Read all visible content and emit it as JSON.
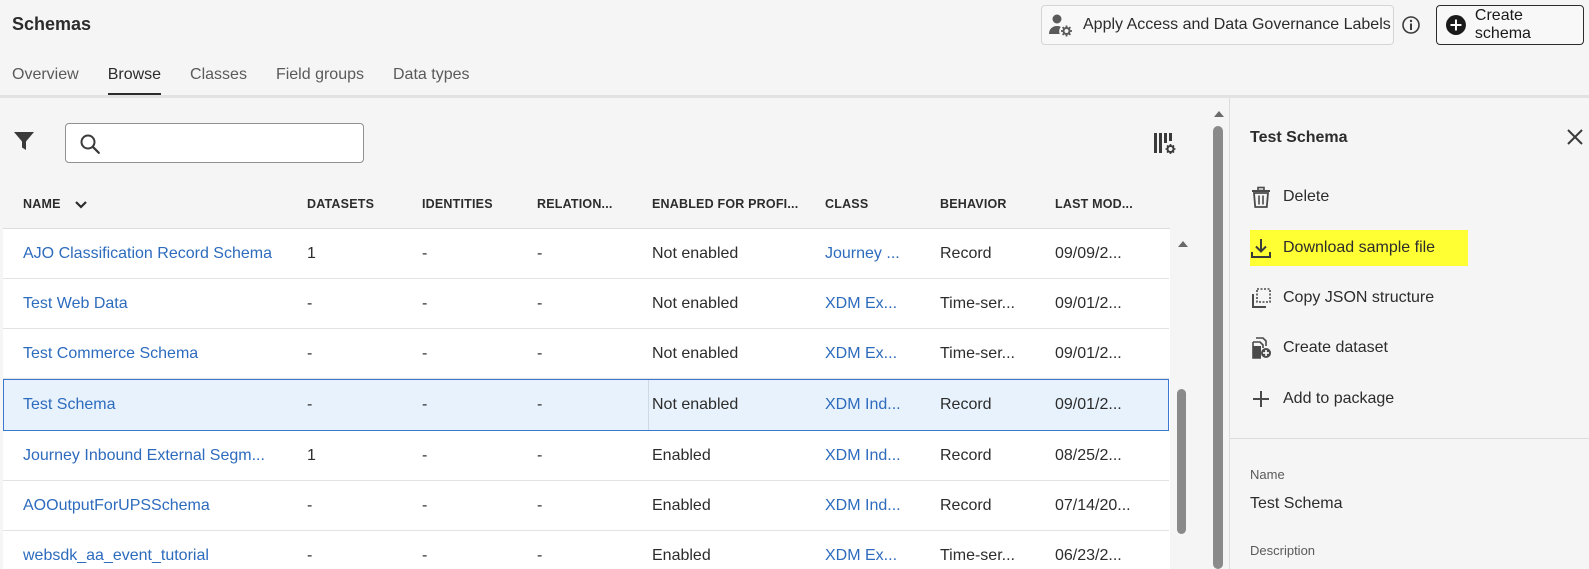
{
  "header": {
    "title": "Schemas",
    "apply_labels_button": "Apply Access and Data Governance Labels",
    "create_schema_button": "Create schema"
  },
  "tabs": [
    {
      "label": "Overview",
      "active": false
    },
    {
      "label": "Browse",
      "active": true
    },
    {
      "label": "Classes",
      "active": false
    },
    {
      "label": "Field groups",
      "active": false
    },
    {
      "label": "Data types",
      "active": false
    }
  ],
  "search": {
    "value": "",
    "placeholder": ""
  },
  "table": {
    "columns": [
      "NAME",
      "DATASETS",
      "IDENTITIES",
      "RELATION...",
      "ENABLED FOR PROFI...",
      "CLASS",
      "BEHAVIOR",
      "LAST MOD..."
    ],
    "sort_column": "NAME",
    "rows": [
      {
        "name": "AJO Classification Record Schema",
        "datasets": "1",
        "identities": "-",
        "relationships": "-",
        "profile": "Not enabled",
        "class": "Journey ...",
        "behavior": "Record",
        "last_modified": "09/09/2..."
      },
      {
        "name": "Test Web Data",
        "datasets": "-",
        "identities": "-",
        "relationships": "-",
        "profile": "Not enabled",
        "class": "XDM Ex...",
        "behavior": "Time-ser...",
        "last_modified": "09/01/2..."
      },
      {
        "name": "Test Commerce Schema",
        "datasets": "-",
        "identities": "-",
        "relationships": "-",
        "profile": "Not enabled",
        "class": "XDM Ex...",
        "behavior": "Time-ser...",
        "last_modified": "09/01/2..."
      },
      {
        "name": "Test Schema",
        "datasets": "-",
        "identities": "-",
        "relationships": "-",
        "profile": "Not enabled",
        "class": "XDM Ind...",
        "behavior": "Record",
        "last_modified": "09/01/2...",
        "selected": true
      },
      {
        "name": "Journey Inbound External Segm...",
        "datasets": "1",
        "identities": "-",
        "relationships": "-",
        "profile": "Enabled",
        "class": "XDM Ind...",
        "behavior": "Record",
        "last_modified": "08/25/2..."
      },
      {
        "name": "AOOutputForUPSSchema",
        "datasets": "-",
        "identities": "-",
        "relationships": "-",
        "profile": "Enabled",
        "class": "XDM Ind...",
        "behavior": "Record",
        "last_modified": "07/14/20..."
      },
      {
        "name": "websdk_aa_event_tutorial",
        "datasets": "-",
        "identities": "-",
        "relationships": "-",
        "profile": "Enabled",
        "class": "XDM Ex...",
        "behavior": "Time-ser...",
        "last_modified": "06/23/2..."
      }
    ]
  },
  "panel": {
    "title": "Test Schema",
    "actions": [
      {
        "label": "Delete",
        "icon": "trash-icon"
      },
      {
        "label": "Download sample file",
        "icon": "download-icon",
        "highlighted": true
      },
      {
        "label": "Copy JSON structure",
        "icon": "copy-icon"
      },
      {
        "label": "Create dataset",
        "icon": "dataset-add-icon"
      },
      {
        "label": "Add to package",
        "icon": "plus-icon"
      }
    ],
    "name_label": "Name",
    "name_value": "Test Schema",
    "description_label": "Description"
  },
  "colors": {
    "link": "#2d6bbd",
    "selected_row_bg": "#e8f2fd",
    "selected_row_border": "#3a78d1",
    "highlight": "#ffff33"
  }
}
